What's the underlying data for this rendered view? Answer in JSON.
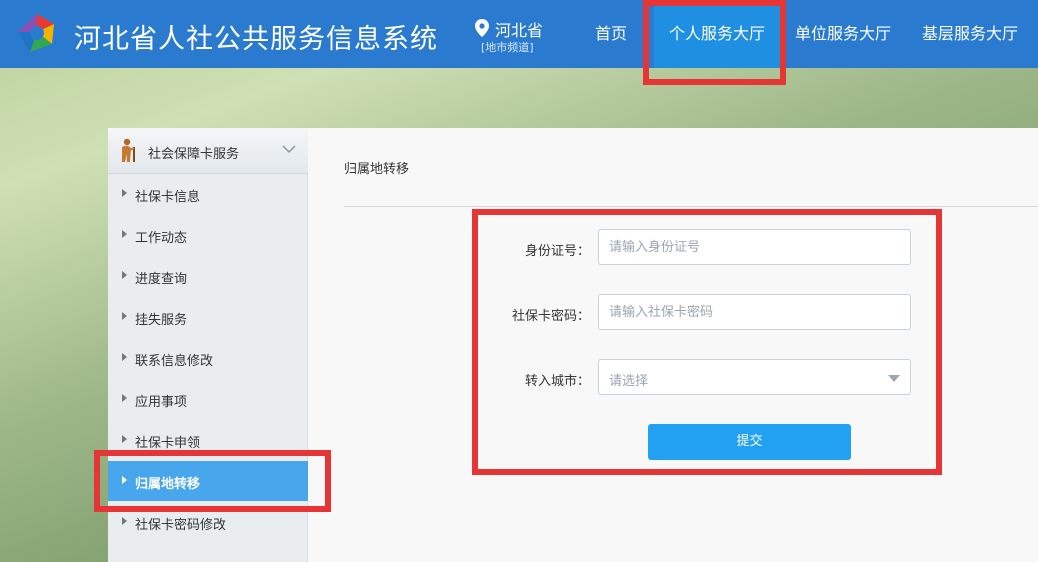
{
  "header": {
    "title": "河北省人社公共服务信息系统",
    "province": "河北省",
    "channel": "[地市频道]",
    "nav": [
      {
        "label": "首页"
      },
      {
        "label": "个人服务大厅"
      },
      {
        "label": "单位服务大厅"
      },
      {
        "label": "基层服务大厅"
      }
    ],
    "active_nav_color": "#1f8fe2",
    "bar_color": "#2a7bd0"
  },
  "sidebar": {
    "section_title": "社会保障卡服务",
    "items": [
      {
        "label": "社保卡信息"
      },
      {
        "label": "工作动态"
      },
      {
        "label": "进度查询"
      },
      {
        "label": "挂失服务"
      },
      {
        "label": "联系信息修改"
      },
      {
        "label": "应用事项"
      },
      {
        "label": "社保卡申领"
      },
      {
        "label": "归属地转移"
      },
      {
        "label": "社保卡密码修改"
      }
    ],
    "active_item": "归属地转移"
  },
  "main": {
    "breadcrumb": "归属地转移",
    "form": {
      "id_label": "身份证号：",
      "id_placeholder": "请输入身份证号",
      "pwd_label": "社保卡密码：",
      "pwd_placeholder": "请输入社保卡密码",
      "city_label": "转入城市：",
      "city_placeholder": "请选择",
      "submit_label": "提交"
    }
  },
  "highlight_color": "#e53535"
}
